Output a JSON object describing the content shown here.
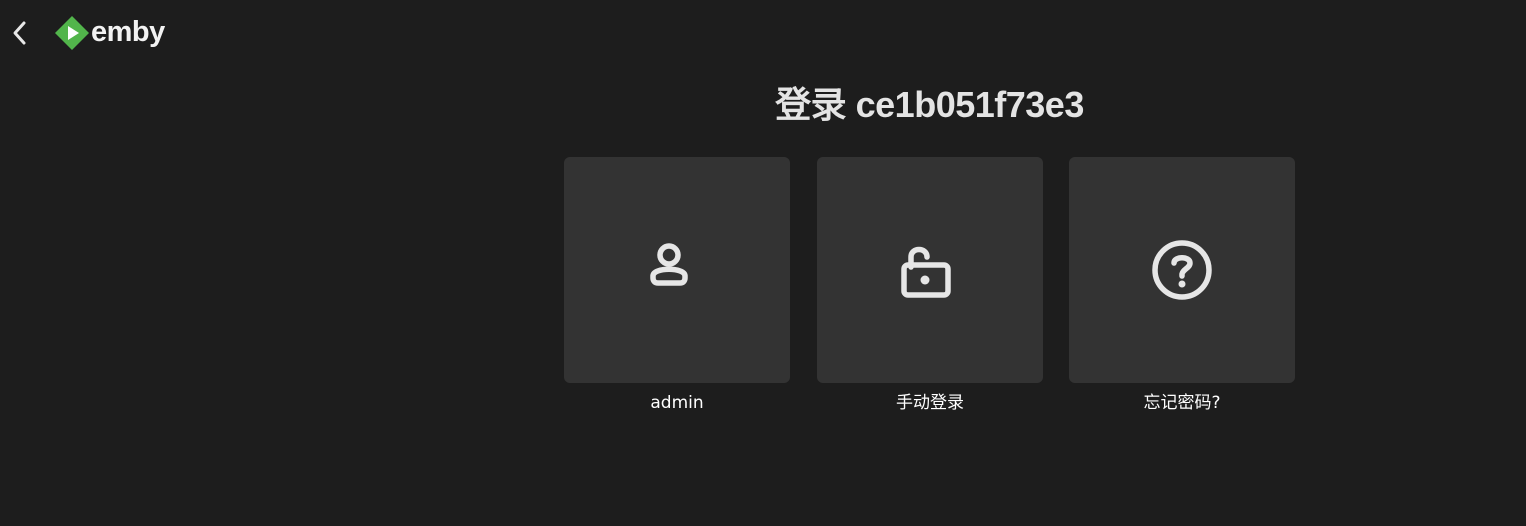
{
  "header": {
    "logo_text": "emby",
    "back_icon": "chevron-left-icon",
    "brand_color": "#52b54b"
  },
  "page": {
    "title": "登录 ce1b051f73e3"
  },
  "cards": [
    {
      "label": "admin",
      "icon": "user-icon"
    },
    {
      "label": "手动登录",
      "icon": "unlock-icon"
    },
    {
      "label": "忘记密码?",
      "icon": "help-circle-icon"
    }
  ]
}
